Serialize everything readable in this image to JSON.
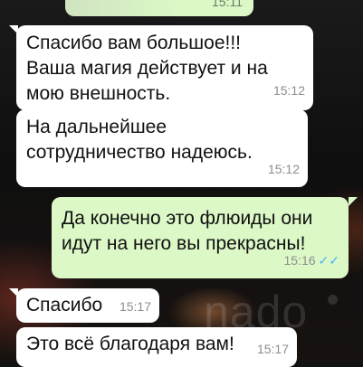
{
  "messages": [
    {
      "text": "",
      "time": "15:11",
      "direction": "out"
    },
    {
      "text": "Спасибо вам большое!!!\nВаша магия действует и на\nмою внешность.",
      "time": "15:12",
      "direction": "in"
    },
    {
      "text": "На дальнейшее\nсотрудничество надеюсь.",
      "time": "15:12",
      "direction": "in"
    },
    {
      "text": "Да конечно это флюиды они\nидут на него вы прекрасны!",
      "time": "15:16",
      "direction": "out",
      "read_icon": "double-check-icon"
    },
    {
      "text": "Спасибо",
      "time": "15:17",
      "direction": "in"
    },
    {
      "text": "Это всё благодаря вам!",
      "time": "15:17",
      "direction": "in"
    }
  ],
  "watermark": {
    "text": "nado"
  },
  "colors": {
    "incoming": "#ffffff",
    "outgoing": "#dcf8c6",
    "read_check": "#4fb3f6"
  }
}
